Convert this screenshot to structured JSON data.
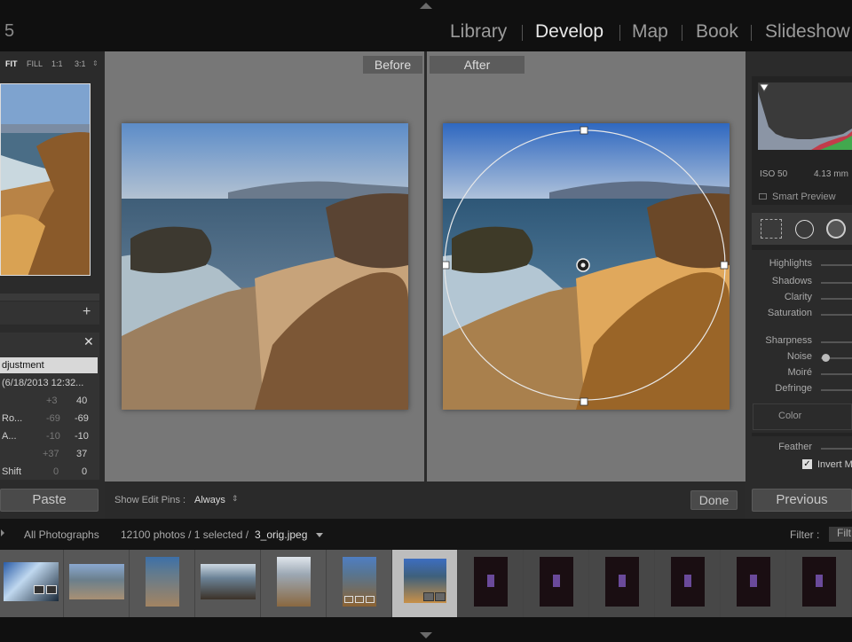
{
  "app": {
    "version_fragment": "5"
  },
  "modules": [
    {
      "label": "Library"
    },
    {
      "label": "Develop"
    },
    {
      "label": "Map"
    },
    {
      "label": "Book"
    },
    {
      "label": "Slideshow"
    }
  ],
  "navigator": {
    "zoom": [
      "FIT",
      "FILL",
      "1:1",
      "3:1"
    ]
  },
  "history": {
    "title": "djustment",
    "rows": [
      {
        "name": "(6/18/2013 12:32...",
        "a": "",
        "b": ""
      },
      {
        "name": "",
        "a": "+3",
        "b": "40"
      },
      {
        "name": "Ro...",
        "a": "-69",
        "b": "-69"
      },
      {
        "name": "A...",
        "a": "-10",
        "b": "-10"
      },
      {
        "name": "",
        "a": "+37",
        "b": "37"
      },
      {
        "name": "Shift",
        "a": "0",
        "b": "0"
      }
    ]
  },
  "compare": {
    "before_label": "Before",
    "after_label": "After"
  },
  "toolbar": {
    "pins_label": "Show Edit Pins :",
    "pins_value": "Always",
    "done_label": "Done"
  },
  "left_buttons": {
    "paste": "Paste"
  },
  "right_panel": {
    "iso": "ISO 50",
    "focal": "4.13 mm",
    "smart_preview": "Smart Preview",
    "sliders": [
      "Highlights",
      "Shadows",
      "Clarity",
      "Saturation",
      "Sharpness",
      "Noise",
      "Moiré",
      "Defringe"
    ],
    "color": "Color",
    "feather": "Feather",
    "invert": "Invert M",
    "previous": "Previous"
  },
  "filmbar": {
    "source": "All Photographs",
    "count": "12100 photos / 1 selected / ",
    "filename": "3_orig.jpeg",
    "filter_label": "Filter :",
    "filter_value": "Filt"
  },
  "colors": {
    "accent": "#e8e8e8",
    "panel": "#2b2b2b",
    "canvas": "#777777"
  }
}
